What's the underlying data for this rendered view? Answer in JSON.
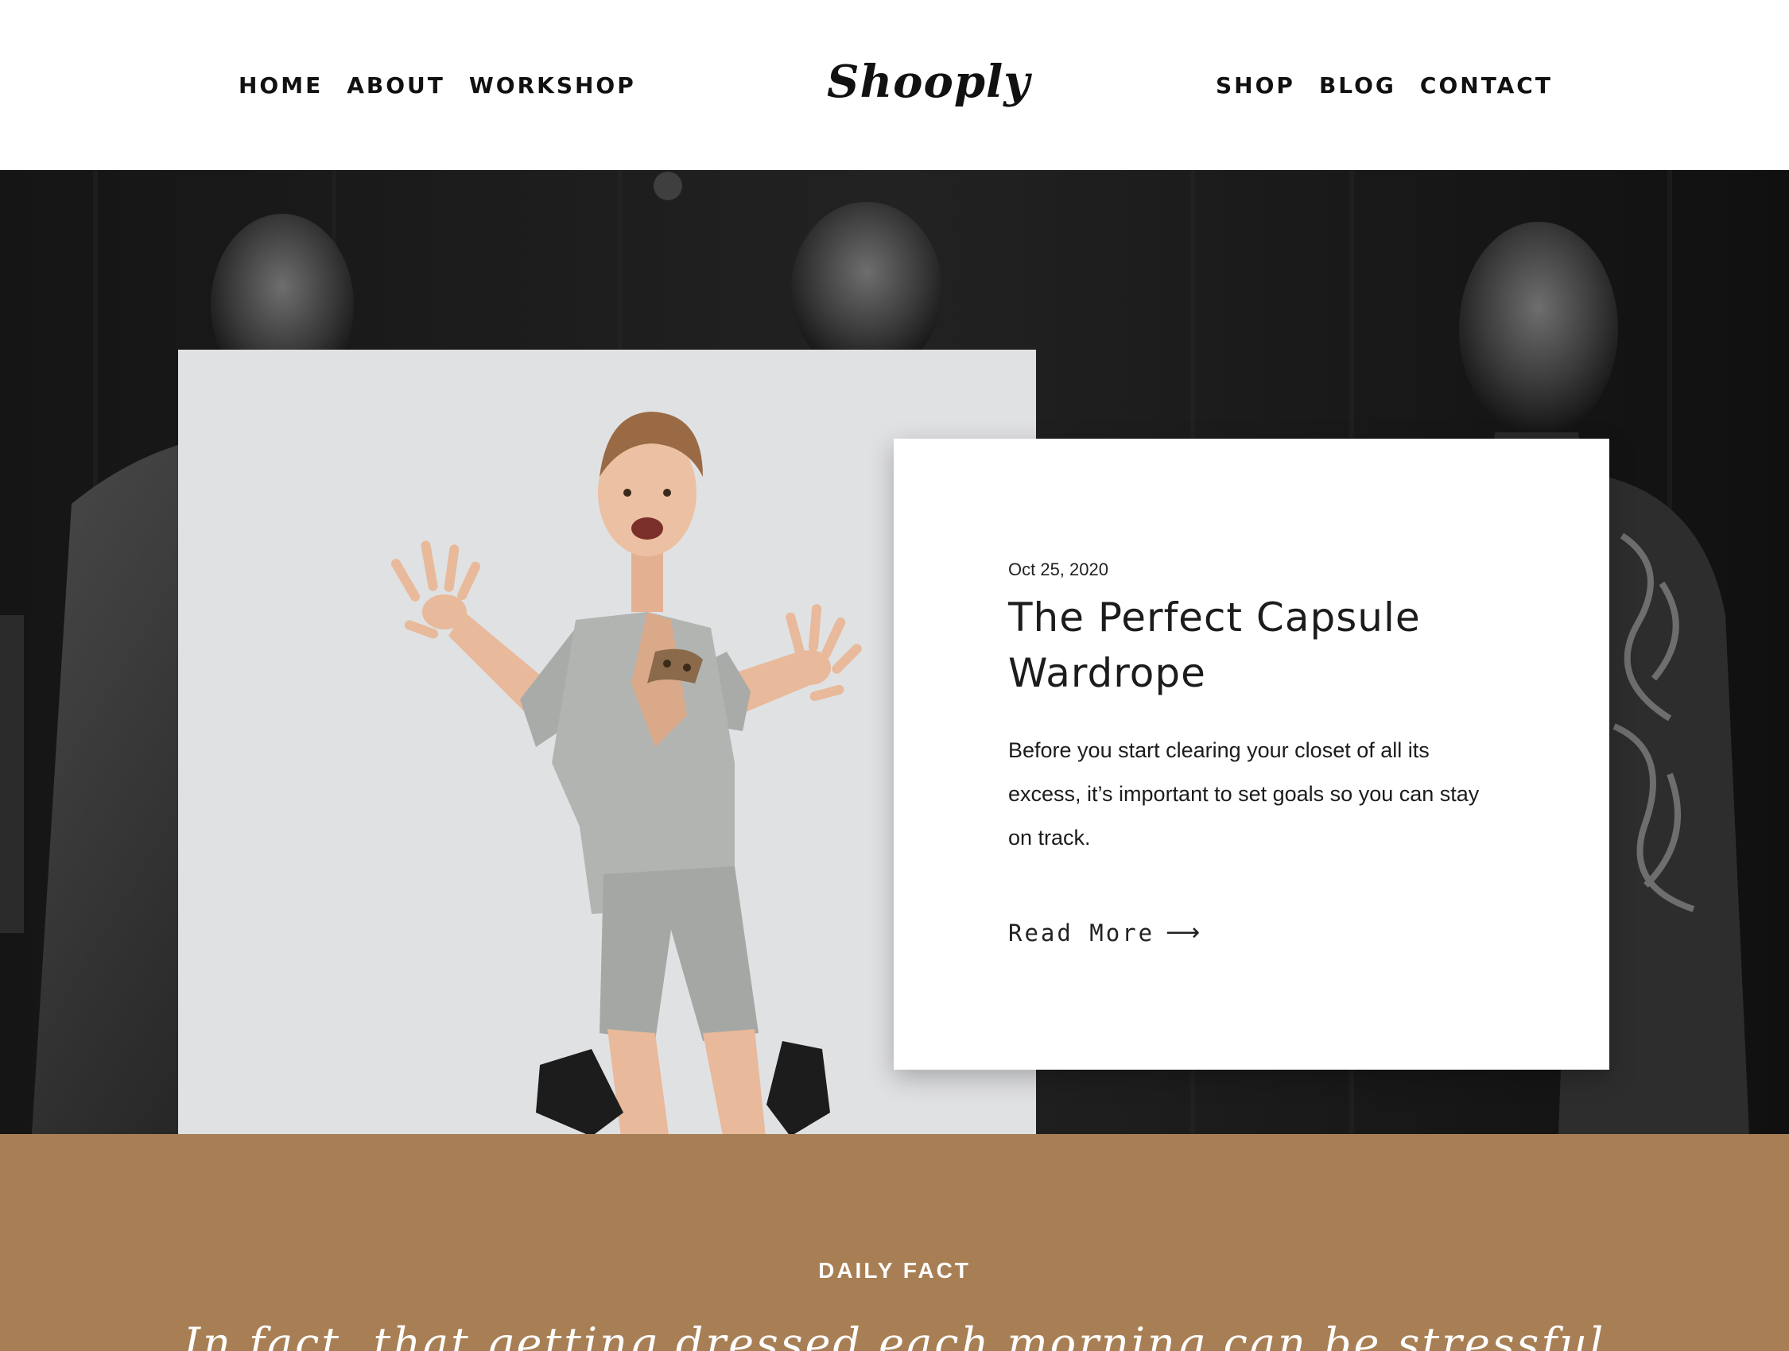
{
  "nav_left": [
    "HOME",
    "ABOUT",
    "WORKSHOP"
  ],
  "nav_right": [
    "SHOP",
    "BLOG",
    "CONTACT"
  ],
  "logo": "Shooply",
  "post": {
    "date": "Oct 25, 2020",
    "title": "The Perfect Capsule Wardrope",
    "excerpt": "Before you start clearing your closet of all its excess, it’s important to set goals so you can stay on track.",
    "read_more": "Read More",
    "read_more_icon": "arrow-right-icon"
  },
  "fact": {
    "label": "DAILY FACT",
    "quote": "In fact, that getting dressed each morning can be stressful"
  },
  "colors": {
    "fact_background": "#a87f54",
    "photo_background": "#e0e1e3",
    "hero_background": "#0c0c0c"
  }
}
